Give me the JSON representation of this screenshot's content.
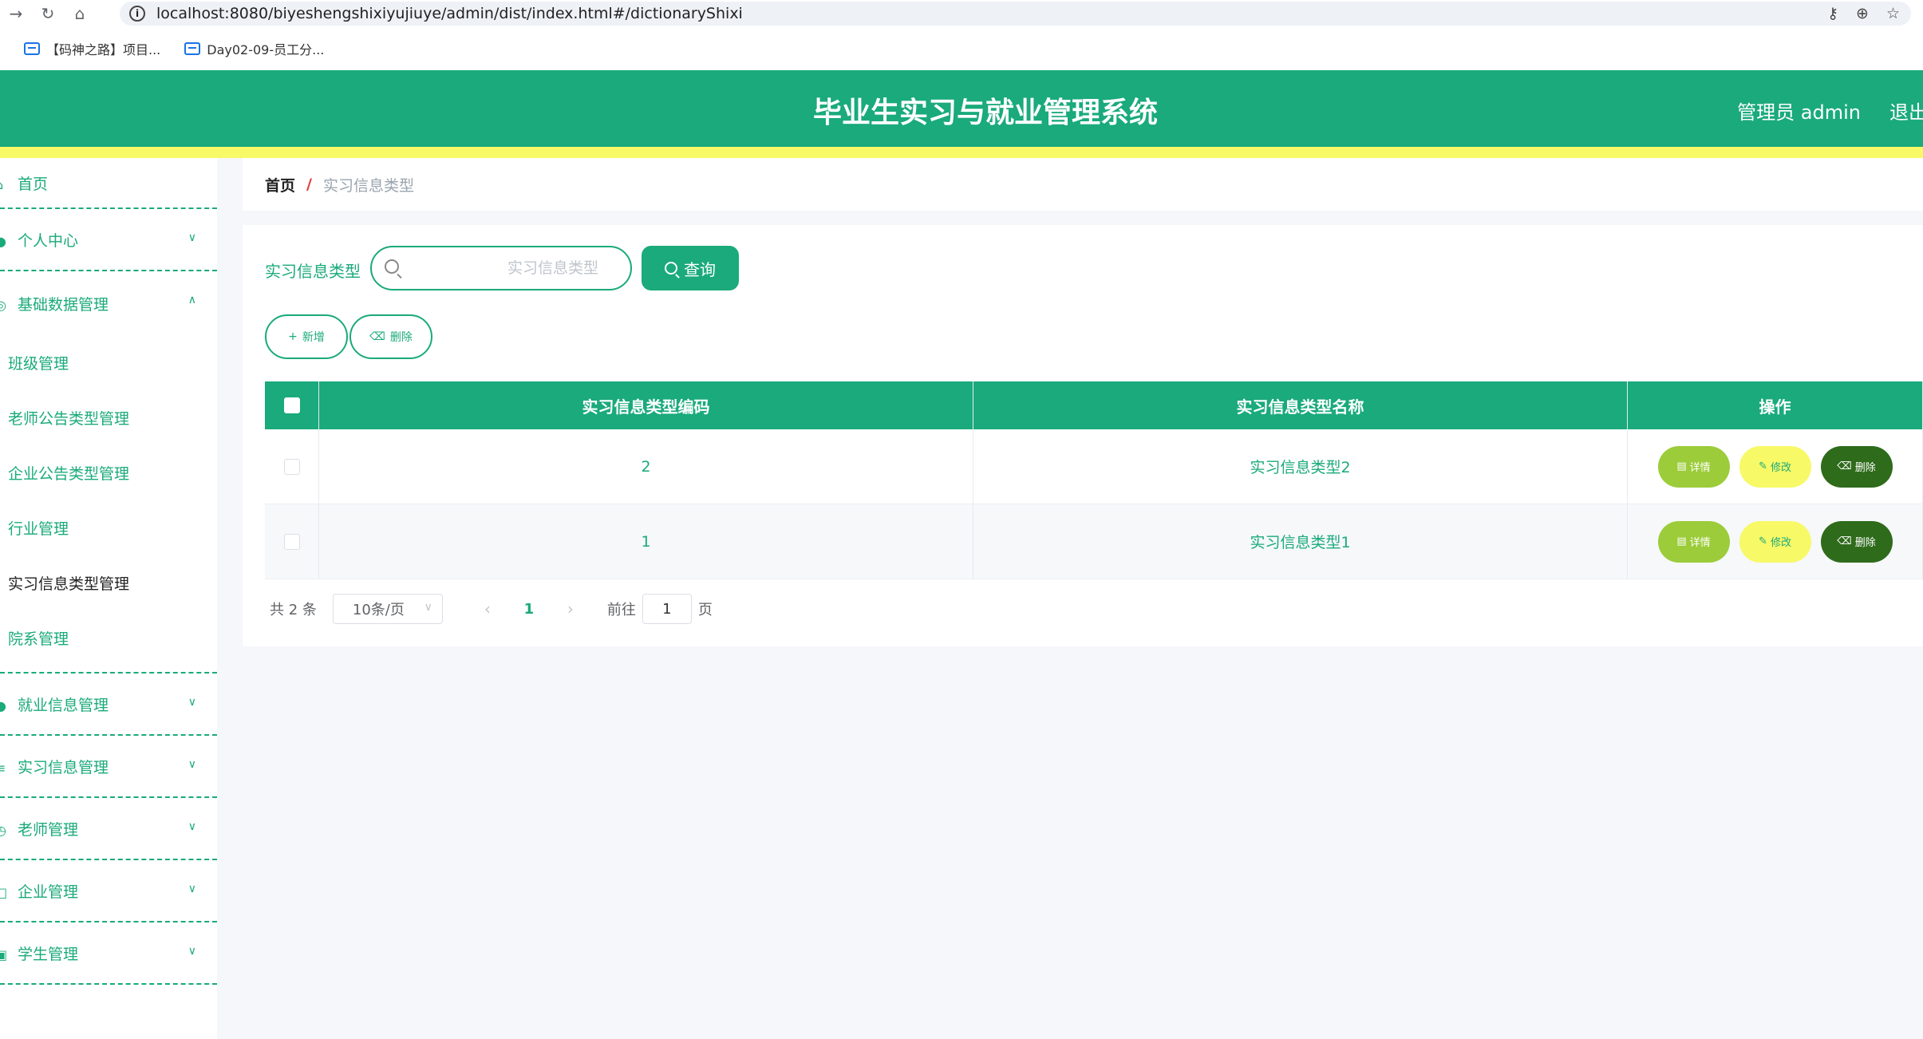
{
  "browser": {
    "url": "localhost:8080/biyeshengshixiyujiuye/admin/dist/index.html#/dictionaryShixi",
    "bookmarks": [
      "【码神之路】项目...",
      "Day02-09-员工分..."
    ]
  },
  "header": {
    "title": "毕业生实习与就业管理系统",
    "admin": "管理员 admin",
    "logout": "退出登录"
  },
  "sidebar": {
    "home": "首页",
    "personal": "个人中心",
    "basic": "基础数据管理",
    "basic_items": [
      "班级管理",
      "老师公告类型管理",
      "企业公告类型管理",
      "行业管理",
      "实习信息类型管理",
      "院系管理"
    ],
    "employment": "就业信息管理",
    "internship": "实习信息管理",
    "teacher": "老师管理",
    "company": "企业管理",
    "student": "学生管理"
  },
  "breadcrumb": {
    "home": "首页",
    "separator": "/",
    "current": "实习信息类型"
  },
  "search": {
    "label": "实习信息类型",
    "placeholder": "实习信息类型",
    "button": "查询"
  },
  "actions": {
    "add": "新增",
    "delete": "删除"
  },
  "table": {
    "headers": [
      "实习信息类型编码",
      "实习信息类型名称",
      "操作"
    ],
    "rows": [
      {
        "code": "2",
        "name": "实习信息类型2"
      },
      {
        "code": "1",
        "name": "实习信息类型1"
      }
    ],
    "ops": {
      "detail": "详情",
      "edit": "修改",
      "remove": "删除"
    }
  },
  "pagination": {
    "total": "共 2 条",
    "page_size": "10条/页",
    "current_page": "1",
    "goto_label": "前往",
    "goto_value": "1",
    "page_suffix": "页"
  },
  "colors": {
    "primary": "#1aaa7b",
    "accent_yellow": "#f7f967",
    "detail_green": "#9ccc3a",
    "remove_dark": "#2e6b1b"
  }
}
